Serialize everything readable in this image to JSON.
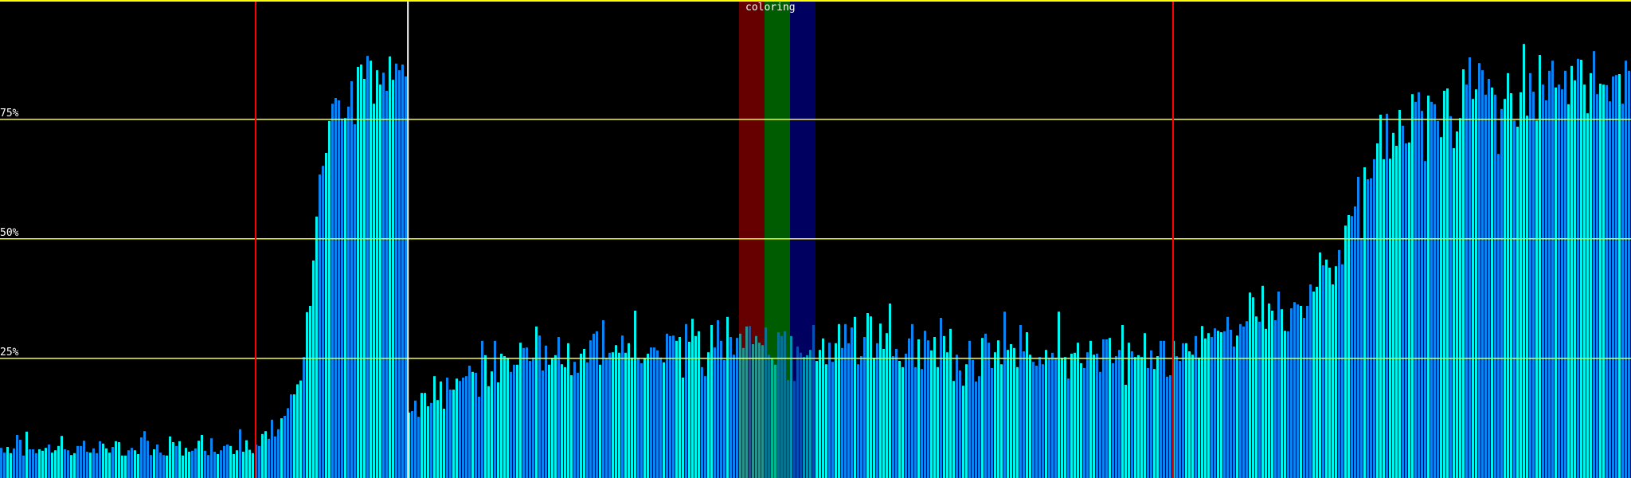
{
  "chart_data": {
    "type": "bar",
    "title": "coloring",
    "xlabel": "",
    "ylabel": "",
    "ylim": [
      0,
      100
    ],
    "y_ticks": [
      {
        "value": 75,
        "label": "75%"
      },
      {
        "value": 50,
        "label": "50%"
      },
      {
        "value": 25,
        "label": "25%"
      }
    ],
    "grid": true,
    "bar_count": 512,
    "colors": {
      "background": "#000000",
      "grid": "#ffff00",
      "bar_a": "#00f5f0",
      "bar_b": "#0a84f0",
      "marker_red": "#ff0000",
      "marker_white": "#ffffff",
      "band_red": "#660000",
      "band_green": "#005c00",
      "band_blue": "#000060"
    },
    "markers": [
      {
        "bar_index": 80,
        "color": "red"
      },
      {
        "bar_index": 127.8,
        "color": "white"
      },
      {
        "bar_index": 368,
        "color": "red"
      }
    ],
    "bands": [
      {
        "from_bar": 232,
        "to_bar": 240,
        "color": "red"
      },
      {
        "from_bar": 240,
        "to_bar": 248,
        "color": "green"
      },
      {
        "from_bar": 248,
        "to_bar": 256,
        "color": "blue"
      }
    ],
    "values": [
      6.3,
      5.3,
      6.5,
      5.2,
      6.2,
      9.0,
      8.0,
      4.7,
      9.7,
      6.0,
      6.0,
      5.2,
      6.0,
      5.7,
      6.3,
      7.0,
      5.3,
      5.8,
      6.7,
      8.8,
      6.0,
      5.8,
      4.8,
      5.2,
      6.7,
      6.7,
      7.8,
      5.5,
      5.3,
      6.2,
      5.2,
      7.7,
      7.2,
      6.2,
      5.3,
      6.5,
      7.7,
      7.5,
      4.7,
      4.7,
      5.8,
      6.3,
      5.8,
      5.0,
      8.5,
      9.8,
      7.8,
      4.8,
      6.0,
      7.0,
      5.3,
      4.8,
      4.7,
      8.7,
      7.5,
      6.7,
      7.7,
      4.7,
      6.3,
      5.5,
      5.7,
      6.2,
      7.8,
      9.0,
      5.7,
      4.8,
      8.3,
      5.5,
      5.0,
      5.8,
      6.7,
      7.0,
      6.7,
      5.0,
      5.8,
      10.2,
      5.5,
      7.9,
      5.9,
      5.2,
      7.0,
      6.7,
      9.2,
      9.8,
      8.2,
      12.2,
      8.7,
      10.2,
      12.5,
      13.0,
      14.6,
      17.5,
      17.5,
      19.6,
      20.4,
      25.3,
      34.7,
      36.0,
      45.5,
      54.7,
      63.5,
      65.3,
      68.0,
      74.7,
      78.3,
      79.5,
      79.0,
      75.2,
      75.3,
      77.7,
      83.0,
      74.0,
      86.0,
      86.5,
      83.5,
      88.3,
      87.3,
      78.3,
      85.3,
      82.3,
      84.8,
      81.0,
      88.2,
      83.3,
      86.7,
      85.3,
      86.5,
      84.0,
      13.7,
      14.0,
      16.2,
      12.8,
      17.8,
      17.8,
      15.0,
      15.7,
      21.3,
      16.3,
      20.2,
      14.5,
      21.0,
      18.5,
      18.5,
      20.8,
      20.3,
      21.0,
      21.3,
      23.5,
      22.2,
      22.0,
      17.0,
      28.7,
      25.7,
      19.2,
      22.3,
      28.7,
      20.0,
      26.0,
      25.5,
      25.0,
      22.2,
      23.7,
      23.7,
      28.3,
      27.2,
      27.3,
      24.5,
      25.2,
      31.7,
      29.8,
      22.5,
      27.7,
      23.7,
      25.0,
      25.7,
      29.5,
      23.8,
      23.2,
      28.2,
      21.5,
      24.3,
      22.0,
      26.0,
      27.0,
      24.2,
      28.8,
      30.2,
      30.7,
      23.7,
      33.0,
      25.0,
      26.2,
      26.3,
      27.8,
      26.2,
      29.8,
      26.2,
      28.2,
      25.2,
      35.0,
      25.0,
      24.0,
      25.0,
      26.0,
      27.3,
      27.3,
      26.7,
      25.2,
      24.2,
      30.2,
      29.7,
      29.8,
      28.7,
      29.5,
      21.0,
      32.2,
      28.5,
      33.3,
      29.7,
      30.7,
      23.2,
      21.3,
      26.3,
      32.0,
      27.3,
      33.0,
      28.7,
      24.7,
      33.7,
      29.5,
      25.8,
      29.3,
      30.2,
      27.2,
      31.7,
      31.8,
      28.0,
      29.7,
      28.3,
      27.8,
      31.5,
      25.8,
      25.0,
      23.7,
      30.5,
      29.7,
      30.7,
      20.5,
      29.7,
      20.3,
      27.5,
      26.2,
      25.3,
      25.7,
      26.8,
      32.0,
      24.5,
      26.8,
      29.2,
      23.8,
      28.3,
      24.3,
      28.2,
      32.2,
      27.2,
      32.2,
      28.2,
      31.5,
      33.7,
      23.8,
      25.5,
      29.5,
      34.5,
      33.8,
      25.0,
      28.2,
      32.3,
      27.0,
      30.3,
      36.5,
      25.5,
      27.0,
      24.5,
      23.2,
      26.0,
      29.2,
      32.2,
      23.2,
      29.0,
      22.8,
      30.8,
      28.8,
      26.7,
      29.5,
      23.2,
      33.5,
      29.7,
      26.3,
      31.2,
      20.3,
      25.8,
      22.5,
      19.3,
      23.8,
      28.7,
      24.7,
      20.2,
      21.3,
      29.3,
      30.2,
      28.3,
      23.0,
      26.3,
      28.8,
      23.8,
      34.8,
      26.8,
      28.0,
      27.2,
      23.2,
      32.0,
      26.5,
      30.5,
      25.8,
      24.3,
      23.5,
      25.3,
      23.8,
      26.8,
      25.0,
      26.2,
      25.0,
      34.8,
      25.0,
      25.3,
      20.8,
      26.0,
      26.2,
      28.3,
      24.0,
      23.0,
      26.3,
      28.7,
      25.8,
      26.0,
      22.2,
      29.0,
      29.0,
      29.3,
      24.0,
      25.5,
      26.8,
      32.0,
      19.5,
      28.3,
      26.5,
      25.3,
      25.7,
      25.3,
      30.3,
      23.0,
      26.7,
      22.8,
      25.5,
      28.7,
      28.7,
      21.2,
      21.5,
      28.7,
      25.5,
      24.5,
      28.2,
      28.2,
      26.5,
      25.8,
      29.7,
      25.2,
      31.8,
      29.2,
      30.3,
      29.5,
      31.3,
      30.8,
      30.5,
      30.7,
      33.7,
      31.0,
      27.5,
      29.8,
      32.2,
      31.7,
      32.8,
      38.8,
      37.8,
      33.8,
      32.7,
      40.2,
      31.2,
      36.5,
      35.0,
      33.0,
      39.0,
      35.3,
      30.8,
      30.7,
      35.5,
      36.8,
      36.3,
      36.0,
      33.5,
      36.0,
      40.5,
      39.0,
      40.0,
      47.2,
      44.5,
      45.7,
      44.0,
      40.5,
      44.3,
      47.7,
      44.7,
      52.8,
      55.0,
      54.8,
      56.8,
      63.0,
      50.0,
      65.0,
      62.5,
      62.7,
      66.7,
      70.0,
      76.0,
      66.7,
      76.2,
      66.8,
      72.2,
      69.5,
      77.0,
      73.7,
      70.0,
      70.2,
      80.3,
      78.7,
      80.7,
      76.8,
      66.3,
      80.0,
      78.7,
      78.2,
      74.7,
      71.3,
      81.0,
      81.5,
      75.7,
      69.0,
      72.5,
      75.3,
      85.5,
      82.3,
      88.0,
      79.3,
      81.3,
      86.8,
      85.3,
      80.2,
      83.5,
      81.7,
      80.2,
      67.8,
      77.2,
      79.3,
      84.7,
      80.5,
      74.8,
      73.5,
      80.7,
      90.8,
      75.8,
      84.7,
      80.8,
      74.8,
      88.5,
      82.3,
      79.0,
      85.2,
      87.3,
      81.7,
      82.3,
      81.3,
      85.2,
      78.2,
      86.2,
      83.2,
      87.7,
      87.5,
      82.3,
      76.3,
      84.7,
      89.3,
      80.3,
      82.5,
      82.3,
      82.2,
      78.8,
      84.0,
      84.3,
      84.5,
      78.3,
      87.3,
      85.2
    ]
  }
}
